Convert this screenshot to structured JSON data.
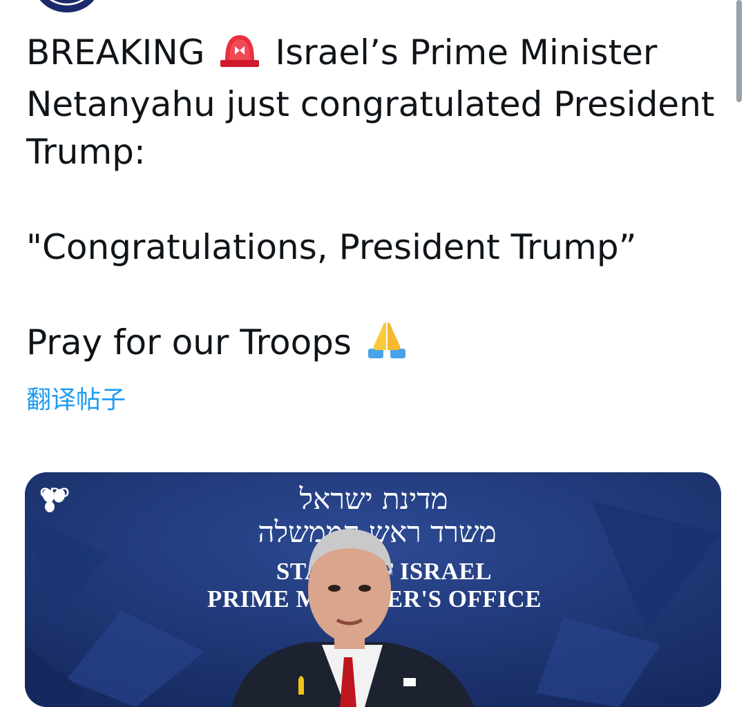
{
  "tweet": {
    "line1_before": "BREAKING",
    "line1_emoji": "police-car-light-emoji",
    "line1_after": "Israel’s Prime Minister",
    "line2": "Netanyahu just congratulated President",
    "line3": "Trump:",
    "quote": "\"Congratulations, President Trump”",
    "closing": "Pray for our Troops",
    "closing_emoji": "folded-hands-emoji"
  },
  "translate_link": "翻译帖子",
  "media": {
    "watermark": "GPO",
    "hebrew_line1": "מדינת ישראל",
    "hebrew_line2": "משרד ראש הממשלה",
    "english_line1": "STATE OF ISRAEL",
    "english_line2": "PRIME MINISTER'S OFFICE"
  },
  "colors": {
    "link": "#1d9bf0",
    "text": "#0f1419",
    "media_background": "#223a7e"
  }
}
